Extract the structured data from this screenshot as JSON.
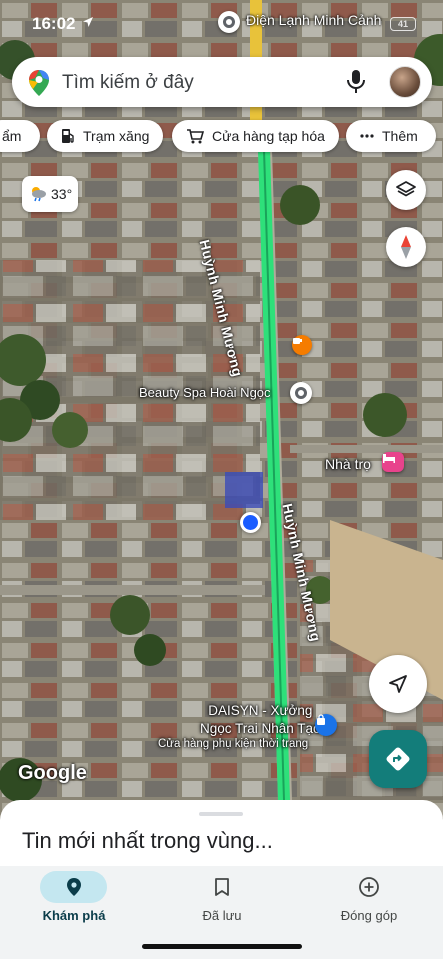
{
  "status_bar": {
    "time": "16:02",
    "battery": "41"
  },
  "search": {
    "placeholder": "Tìm kiếm ở đây"
  },
  "chips": [
    {
      "label": "ẩm",
      "icon": "none"
    },
    {
      "label": "Trạm xăng",
      "icon": "gas-station-icon"
    },
    {
      "label": "Cửa hàng tạp hóa",
      "icon": "cart-icon"
    },
    {
      "label": "Thêm",
      "icon": "more-icon"
    }
  ],
  "weather": {
    "temperature": "33°",
    "icon": "partly-cloudy-rain-icon"
  },
  "map": {
    "places": [
      {
        "name": "Điện Lạnh Minh Cảnh",
        "type": "generic-pin"
      },
      {
        "name": "Beauty Spa Hoài Ngọc",
        "type": "generic-pin"
      },
      {
        "name": "Nhà trọ",
        "type": "hotel-pin"
      },
      {
        "name": "DAISYN - Xưởng\nNgọc Trai Nhân Tạo",
        "type": "shop-pin"
      },
      {
        "name": "Cửa hàng phụ kiện thời trang",
        "type": "subtitle"
      }
    ],
    "streets": [
      "Huỳnh Minh Mương",
      "Huỳnh Minh Mương"
    ],
    "route_color": "#2ee07a",
    "my_location_color": "#1a5cff",
    "watermark": "Google"
  },
  "sheet": {
    "title": "Tin mới nhất trong vùng..."
  },
  "nav": [
    {
      "label": "Khám phá",
      "icon": "explore-pin-icon",
      "active": true
    },
    {
      "label": "Đã lưu",
      "icon": "bookmark-icon",
      "active": false
    },
    {
      "label": "Đóng góp",
      "icon": "add-circle-icon",
      "active": false
    }
  ],
  "colors": {
    "accent": "#137d7a",
    "active_nav_bg": "#c4e7f0"
  }
}
